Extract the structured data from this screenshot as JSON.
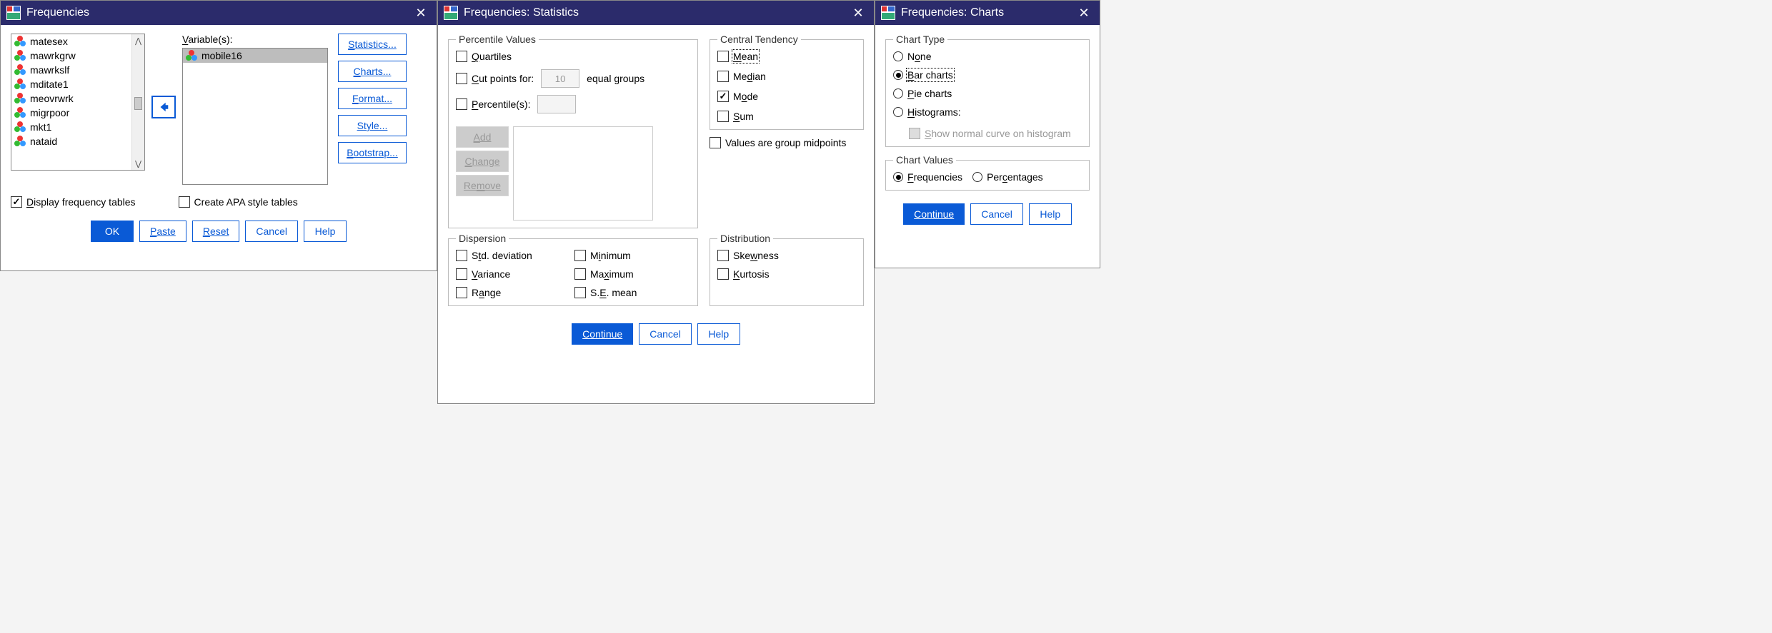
{
  "dlg1": {
    "title": "Frequencies",
    "source_vars": [
      "matesex",
      "mawrkgrw",
      "mawrkslf",
      "mditate1",
      "meovrwrk",
      "migrpoor",
      "mkt1",
      "nataid"
    ],
    "vars_label": "Variable(s):",
    "target_vars": [
      "mobile16"
    ],
    "right_buttons": {
      "statistics": "Statistics...",
      "charts": "Charts...",
      "format": "Format...",
      "style": "Style...",
      "bootstrap": "Bootstrap..."
    },
    "chk_display": "Display frequency tables",
    "chk_apa": "Create APA style tables",
    "buttons": {
      "ok": "OK",
      "paste": "Paste",
      "reset": "Reset",
      "cancel": "Cancel",
      "help": "Help"
    }
  },
  "dlg2": {
    "title": "Frequencies: Statistics",
    "grp_percentile": "Percentile Values",
    "chk_quartiles": "Quartiles",
    "chk_cutpoints_prefix": "Cut points for:",
    "cutpoints_value": "10",
    "chk_cutpoints_suffix": "equal groups",
    "chk_percentiles": "Percentile(s):",
    "btn_add": "Add",
    "btn_change": "Change",
    "btn_remove": "Remove",
    "grp_central": "Central Tendency",
    "chk_mean": "Mean",
    "chk_median": "Median",
    "chk_mode": "Mode",
    "chk_sum": "Sum",
    "chk_midpoints": "Values are group midpoints",
    "grp_dispersion": "Dispersion",
    "chk_std": "Std. deviation",
    "chk_var": "Variance",
    "chk_range": "Range",
    "chk_min": "Minimum",
    "chk_max": "Maximum",
    "chk_se": "S.E. mean",
    "grp_dist": "Distribution",
    "chk_skew": "Skewness",
    "chk_kurt": "Kurtosis",
    "buttons": {
      "continue": "Continue",
      "cancel": "Cancel",
      "help": "Help"
    }
  },
  "dlg3": {
    "title": "Frequencies: Charts",
    "grp_type": "Chart Type",
    "rdo_none": "None",
    "rdo_bar": "Bar charts",
    "rdo_pie": "Pie charts",
    "rdo_hist": "Histograms:",
    "chk_normal": "Show normal curve on histogram",
    "grp_values": "Chart Values",
    "rdo_freq": "Frequencies",
    "rdo_pct": "Percentages",
    "buttons": {
      "continue": "Continue",
      "cancel": "Cancel",
      "help": "Help"
    }
  }
}
